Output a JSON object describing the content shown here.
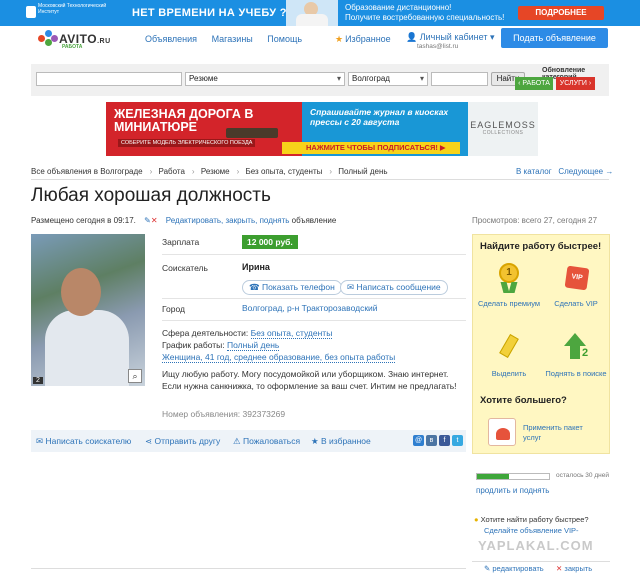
{
  "banner": {
    "university": "Московский Технологический Институт",
    "slogan": "НЕТ ВРЕМЕНИ НА УЧЕБУ ?",
    "line1": "Образование дистанционно!",
    "line2": "Получите востребованную специальность!",
    "cta": "ПОДРОБНЕЕ"
  },
  "header": {
    "logo": "AVITO",
    "logo_suffix": ".RU",
    "logo_sub": "РАБОТА",
    "nav": [
      "Объявления",
      "Магазины",
      "Помощь"
    ],
    "favorites": "Избранное",
    "cabinet": "Личный кабинет",
    "email": "tashas@list.ru",
    "post_button": "Подать объявление"
  },
  "search": {
    "query": "",
    "category": "Резюме",
    "region": "Волгоград",
    "district": "",
    "button": "Найти",
    "update_title": "Обновление категорий",
    "update_work": "‹ РАБОТА",
    "update_services": "УСЛУГИ ›"
  },
  "ad": {
    "title": "ЖЕЛЕЗНАЯ ДОРОГА В МИНИАТЮРЕ",
    "sub": "СОБЕРИТЕ МОДЕЛЬ ЭЛЕКТРИЧЕСКОГО ПОЕЗДА",
    "text": "Спрашивайте журнал в киосках прессы с 20 августа",
    "cta": "НАЖМИТЕ ЧТОБЫ ПОДПИСАТЬСЯ! ▶",
    "brand": "EAGLEMOSS",
    "brand_sub": "COLLECTIONS"
  },
  "breadcrumbs": [
    "Все объявления в Волгограде",
    "Работа",
    "Резюме",
    "Без опыта, студенты",
    "Полный день"
  ],
  "catalog_link": "В каталог",
  "next_link": "Следующее →",
  "title": "Любая хорошая должность",
  "posted": "Размещено сегодня в 09:17.",
  "edit_link": "Редактировать, закрыть, поднять",
  "edit_suffix": "объявление",
  "views": "Просмотров: всего 27, сегодня 27",
  "photo_count": "2",
  "details": {
    "salary_label": "Зарплата",
    "salary": "12 000 руб.",
    "seeker_label": "Соискатель",
    "seeker": "Ирина",
    "show_phone": "Показать телефон",
    "write_message": "Написать сообщение",
    "city_label": "Город",
    "city": "Волгоград, р-н Тракторозаводский",
    "sphere_label": "Сфера деятельности:",
    "sphere": "Без опыта, студенты",
    "schedule_label": "График работы:",
    "schedule": "Полный день",
    "person": "Женщина, 41 год, среднее образование, без опыта работы",
    "description": "Ищу любую работу. Могу посудомойкой или уборщиком. Знаю интернет. Если нужна санкнижка, то оформление за ваш счет. Интим не предлагать!",
    "ad_number_label": "Номер объявления:",
    "ad_number": "392373269"
  },
  "actions": {
    "write": "Написать соискателю",
    "share": "Отправить другу",
    "complain": "Пожаловаться",
    "favorite": "В избранное"
  },
  "sidebar": {
    "heading": "Найдите работу быстрее!",
    "premium": "Сделать премиум",
    "vip": "Сделать VIP",
    "highlight": "Выделить",
    "lift": "Поднять в поиске",
    "more_heading": "Хотите большего?",
    "package": "Применить пакет услуг",
    "progress_text": "осталось 30 дней",
    "progress": 0.45,
    "prolong": "продлить и поднять",
    "q1": "Хотите найти работу быстрее?",
    "q2": "Сделайте объявление VIP-",
    "q3": "",
    "watermark": "YAPLAKAL.COM",
    "foot_edit": "редактировать",
    "foot_close": "закрыть"
  },
  "colors": {
    "accent": "#2d73b8",
    "green": "#3c9e2f",
    "banner_blue": "#1b8fe2",
    "red": "#e64626"
  }
}
